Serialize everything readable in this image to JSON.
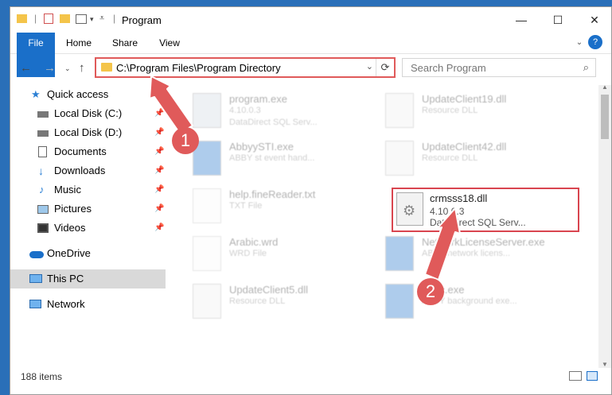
{
  "window": {
    "title": "Program",
    "controls": {
      "minimize": "—",
      "maximize": "☐",
      "close": "✕"
    }
  },
  "ribbon": {
    "tabs": [
      {
        "label": "File"
      },
      {
        "label": "Home"
      },
      {
        "label": "Share"
      },
      {
        "label": "View"
      }
    ],
    "help": "?"
  },
  "address": {
    "path": "C:\\Program Files\\Program Directory",
    "search_placeholder": "Search Program"
  },
  "sidebar": {
    "quick_access": "Quick access",
    "items": [
      {
        "label": "Local Disk (C:)",
        "icon": "drive-icon"
      },
      {
        "label": "Local Disk (D:)",
        "icon": "drive-icon"
      },
      {
        "label": "Documents",
        "icon": "documents-icon"
      },
      {
        "label": "Downloads",
        "icon": "downloads-icon"
      },
      {
        "label": "Music",
        "icon": "music-icon"
      },
      {
        "label": "Pictures",
        "icon": "pictures-icon"
      },
      {
        "label": "Videos",
        "icon": "videos-icon"
      }
    ],
    "onedrive": "OneDrive",
    "this_pc": "This PC",
    "network": "Network"
  },
  "files": [
    {
      "name": "program.exe",
      "line2": "4.10.0.3",
      "line3": "DataDirect SQL Serv..."
    },
    {
      "name": "UpdateClient19.dll",
      "line2": "Resource DLL",
      "line3": ""
    },
    {
      "name": "AbbyySTI.exe",
      "line2": "ABBY st event hand...",
      "line3": ""
    },
    {
      "name": "UpdateClient42.dll",
      "line2": "Resource DLL",
      "line3": ""
    },
    {
      "name": "help.fineReader.txt",
      "line2": "TXT File",
      "line3": ""
    },
    {
      "name": "crmsss18.dll",
      "line2": "4.10.0.3",
      "line3": "DataDirect SQL Serv..."
    },
    {
      "name": "Arabic.wrd",
      "line2": "WRD File",
      "line3": ""
    },
    {
      "name": "NetworkLicenseServer.exe",
      "line2": "ABBY network licens...",
      "line3": ""
    },
    {
      "name": "UpdateClient5.dll",
      "line2": "Resource DLL",
      "line3": ""
    },
    {
      "name": "Exec.exe",
      "line2": "ABBY background exe...",
      "line3": ""
    }
  ],
  "status": {
    "count": "188 items"
  },
  "annotations": {
    "step1": "1",
    "step2": "2",
    "color": "#e05a5a"
  }
}
